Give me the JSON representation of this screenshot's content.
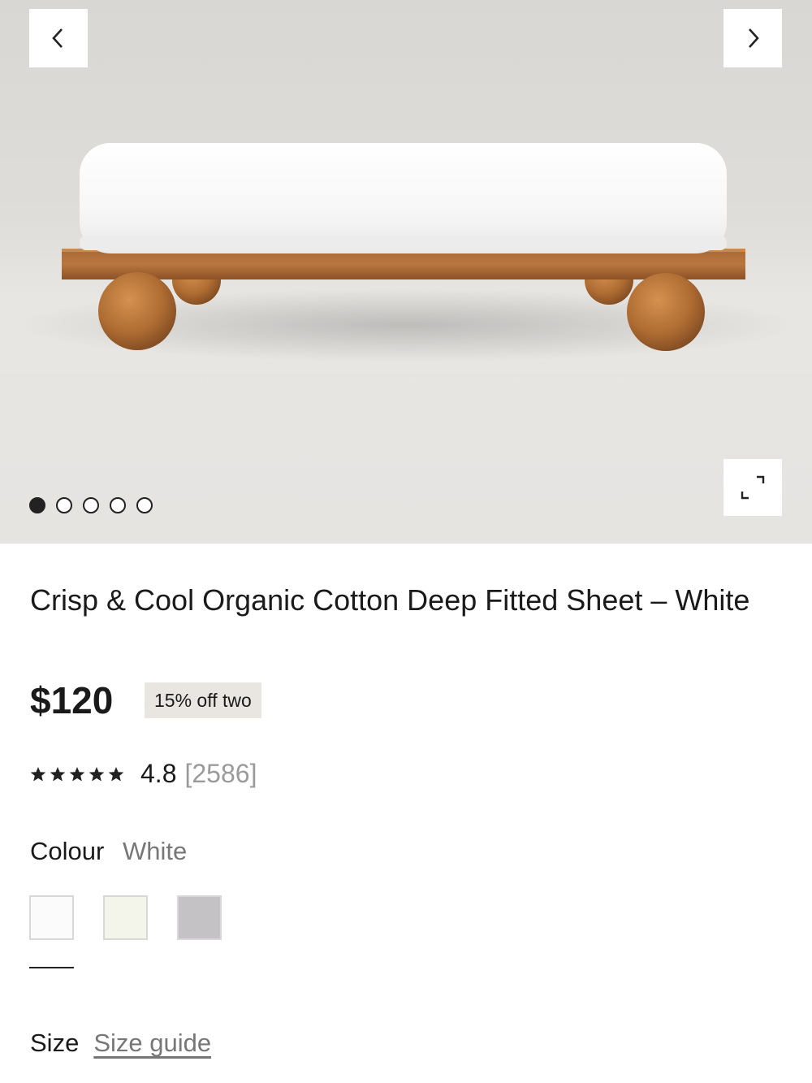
{
  "gallery": {
    "slide_count": 5,
    "active_slide": 1,
    "prev_icon": "chevron-left-icon",
    "next_icon": "chevron-right-icon",
    "expand_icon": "expand-icon"
  },
  "product": {
    "title": "Crisp & Cool Organic Cotton Deep Fitted Sheet – White",
    "price": "$120",
    "promo": "15% off two",
    "rating": {
      "stars": 5,
      "value": "4.8",
      "count": "[2586]"
    }
  },
  "colour": {
    "label": "Colour",
    "selected": "White",
    "swatches": [
      {
        "name": "White",
        "color": "#fbfbfb"
      },
      {
        "name": "Ivory",
        "color": "#f3f5ea"
      },
      {
        "name": "Grey",
        "color": "#c4c2c5"
      }
    ]
  },
  "size": {
    "label": "Size",
    "guide_link": "Size guide"
  }
}
